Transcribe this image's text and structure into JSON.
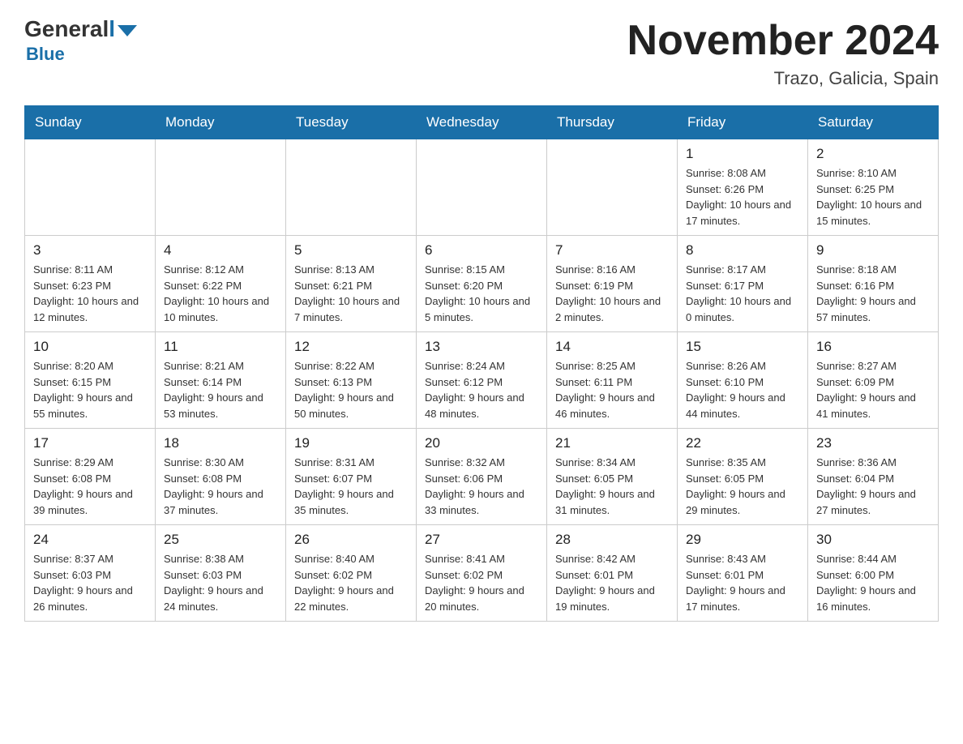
{
  "header": {
    "logo": {
      "general": "General",
      "blue": "Blue"
    },
    "title": "November 2024",
    "subtitle": "Trazo, Galicia, Spain"
  },
  "days_of_week": [
    "Sunday",
    "Monday",
    "Tuesday",
    "Wednesday",
    "Thursday",
    "Friday",
    "Saturday"
  ],
  "weeks": [
    [
      {
        "num": "",
        "info": ""
      },
      {
        "num": "",
        "info": ""
      },
      {
        "num": "",
        "info": ""
      },
      {
        "num": "",
        "info": ""
      },
      {
        "num": "",
        "info": ""
      },
      {
        "num": "1",
        "info": "Sunrise: 8:08 AM\nSunset: 6:26 PM\nDaylight: 10 hours\nand 17 minutes."
      },
      {
        "num": "2",
        "info": "Sunrise: 8:10 AM\nSunset: 6:25 PM\nDaylight: 10 hours\nand 15 minutes."
      }
    ],
    [
      {
        "num": "3",
        "info": "Sunrise: 8:11 AM\nSunset: 6:23 PM\nDaylight: 10 hours\nand 12 minutes."
      },
      {
        "num": "4",
        "info": "Sunrise: 8:12 AM\nSunset: 6:22 PM\nDaylight: 10 hours\nand 10 minutes."
      },
      {
        "num": "5",
        "info": "Sunrise: 8:13 AM\nSunset: 6:21 PM\nDaylight: 10 hours\nand 7 minutes."
      },
      {
        "num": "6",
        "info": "Sunrise: 8:15 AM\nSunset: 6:20 PM\nDaylight: 10 hours\nand 5 minutes."
      },
      {
        "num": "7",
        "info": "Sunrise: 8:16 AM\nSunset: 6:19 PM\nDaylight: 10 hours\nand 2 minutes."
      },
      {
        "num": "8",
        "info": "Sunrise: 8:17 AM\nSunset: 6:17 PM\nDaylight: 10 hours\nand 0 minutes."
      },
      {
        "num": "9",
        "info": "Sunrise: 8:18 AM\nSunset: 6:16 PM\nDaylight: 9 hours\nand 57 minutes."
      }
    ],
    [
      {
        "num": "10",
        "info": "Sunrise: 8:20 AM\nSunset: 6:15 PM\nDaylight: 9 hours\nand 55 minutes."
      },
      {
        "num": "11",
        "info": "Sunrise: 8:21 AM\nSunset: 6:14 PM\nDaylight: 9 hours\nand 53 minutes."
      },
      {
        "num": "12",
        "info": "Sunrise: 8:22 AM\nSunset: 6:13 PM\nDaylight: 9 hours\nand 50 minutes."
      },
      {
        "num": "13",
        "info": "Sunrise: 8:24 AM\nSunset: 6:12 PM\nDaylight: 9 hours\nand 48 minutes."
      },
      {
        "num": "14",
        "info": "Sunrise: 8:25 AM\nSunset: 6:11 PM\nDaylight: 9 hours\nand 46 minutes."
      },
      {
        "num": "15",
        "info": "Sunrise: 8:26 AM\nSunset: 6:10 PM\nDaylight: 9 hours\nand 44 minutes."
      },
      {
        "num": "16",
        "info": "Sunrise: 8:27 AM\nSunset: 6:09 PM\nDaylight: 9 hours\nand 41 minutes."
      }
    ],
    [
      {
        "num": "17",
        "info": "Sunrise: 8:29 AM\nSunset: 6:08 PM\nDaylight: 9 hours\nand 39 minutes."
      },
      {
        "num": "18",
        "info": "Sunrise: 8:30 AM\nSunset: 6:08 PM\nDaylight: 9 hours\nand 37 minutes."
      },
      {
        "num": "19",
        "info": "Sunrise: 8:31 AM\nSunset: 6:07 PM\nDaylight: 9 hours\nand 35 minutes."
      },
      {
        "num": "20",
        "info": "Sunrise: 8:32 AM\nSunset: 6:06 PM\nDaylight: 9 hours\nand 33 minutes."
      },
      {
        "num": "21",
        "info": "Sunrise: 8:34 AM\nSunset: 6:05 PM\nDaylight: 9 hours\nand 31 minutes."
      },
      {
        "num": "22",
        "info": "Sunrise: 8:35 AM\nSunset: 6:05 PM\nDaylight: 9 hours\nand 29 minutes."
      },
      {
        "num": "23",
        "info": "Sunrise: 8:36 AM\nSunset: 6:04 PM\nDaylight: 9 hours\nand 27 minutes."
      }
    ],
    [
      {
        "num": "24",
        "info": "Sunrise: 8:37 AM\nSunset: 6:03 PM\nDaylight: 9 hours\nand 26 minutes."
      },
      {
        "num": "25",
        "info": "Sunrise: 8:38 AM\nSunset: 6:03 PM\nDaylight: 9 hours\nand 24 minutes."
      },
      {
        "num": "26",
        "info": "Sunrise: 8:40 AM\nSunset: 6:02 PM\nDaylight: 9 hours\nand 22 minutes."
      },
      {
        "num": "27",
        "info": "Sunrise: 8:41 AM\nSunset: 6:02 PM\nDaylight: 9 hours\nand 20 minutes."
      },
      {
        "num": "28",
        "info": "Sunrise: 8:42 AM\nSunset: 6:01 PM\nDaylight: 9 hours\nand 19 minutes."
      },
      {
        "num": "29",
        "info": "Sunrise: 8:43 AM\nSunset: 6:01 PM\nDaylight: 9 hours\nand 17 minutes."
      },
      {
        "num": "30",
        "info": "Sunrise: 8:44 AM\nSunset: 6:00 PM\nDaylight: 9 hours\nand 16 minutes."
      }
    ]
  ]
}
